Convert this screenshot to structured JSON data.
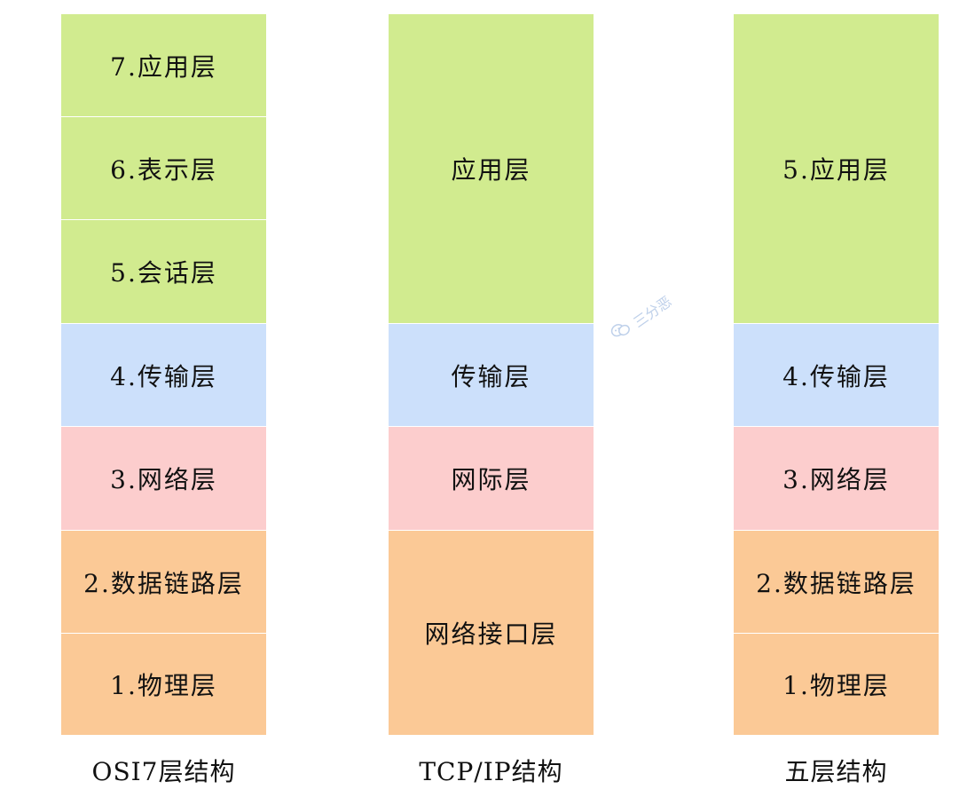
{
  "osi": {
    "caption": "OSI7层结构",
    "layers": [
      "7.应用层",
      "6.表示层",
      "5.会话层",
      "4.传输层",
      "3.网络层",
      "2.数据链路层",
      "1.物理层"
    ]
  },
  "tcpip": {
    "caption": "TCP/IP结构",
    "layers": [
      "应用层",
      "传输层",
      "网际层",
      "网络接口层"
    ]
  },
  "five": {
    "caption": "五层结构",
    "layers": [
      "5.应用层",
      "4.传输层",
      "3.网络层",
      "2.数据链路层",
      "1.物理层"
    ]
  },
  "watermark": {
    "text": "三分恶",
    "icon": "wechat-icon"
  },
  "colors": {
    "application": "#d1eb8f",
    "transport": "#cce0fb",
    "network": "#fccdcd",
    "link_physical": "#fbc996"
  }
}
